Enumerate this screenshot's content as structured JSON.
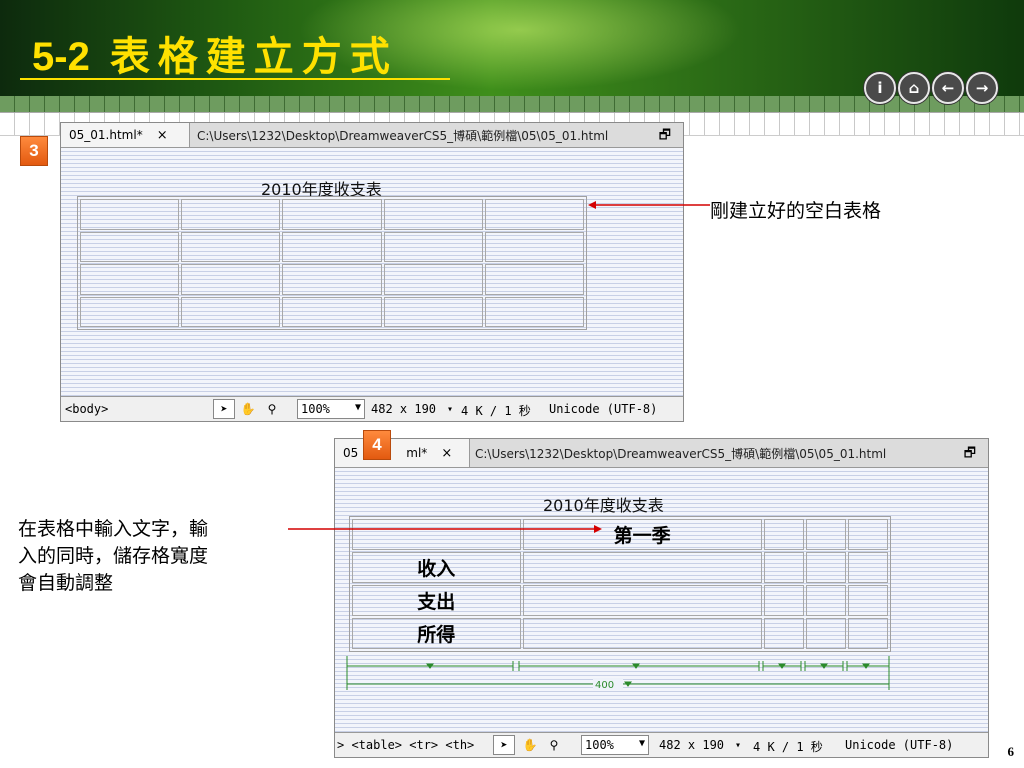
{
  "slide": {
    "title_num": "5-2",
    "title_text": "表格建立方式",
    "page_number": "6"
  },
  "nav": [
    "i",
    "⌂",
    "←",
    "→"
  ],
  "window1": {
    "badge": "3",
    "tab_label": "05_01.html*",
    "tab_close": "×",
    "path": "C:\\Users\\1232\\Desktop\\DreamweaverCS5_博碩\\範例檔\\05\\05_01.html",
    "caption": "2010年度收支表",
    "status_tag": "<body>",
    "zoom": "100%",
    "size": "482 x 190",
    "speed": "4 K / 1 秒",
    "encoding": "Unicode (UTF-8)"
  },
  "window2": {
    "badge": "4",
    "tab_label": "05",
    "tab_label2": "ml*",
    "tab_close": "×",
    "path": "C:\\Users\\1232\\Desktop\\DreamweaverCS5_博碩\\範例檔\\05\\05_01.html",
    "caption": "2010年度收支表",
    "col_header": "第一季",
    "rows": [
      "收入",
      "支出",
      "所得"
    ],
    "width_small": "400",
    "status_tag": "> <table> <tr> <th>",
    "zoom": "100%",
    "size": "482 x 190",
    "speed": "4 K / 1 秒",
    "encoding": "Unicode (UTF-8)"
  },
  "annotations": {
    "blank_table": "剛建立好的空白表格",
    "auto_adjust_1": "在表格中輸入文字，輸",
    "auto_adjust_2": "入的同時，儲存格寬度",
    "auto_adjust_3": "會自動調整"
  },
  "colors": {
    "header_green": "#2b6b16",
    "title_yellow": "#ffe100",
    "badge_orange": "#ef6b1c",
    "arrow_red": "#d40000",
    "width_green": "#2a8a2a"
  }
}
